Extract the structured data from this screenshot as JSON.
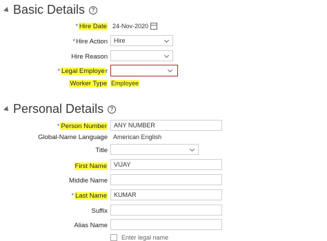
{
  "basic": {
    "title": "Basic Details",
    "fields": {
      "hire_date": {
        "label": "Hire Date",
        "value": "24-Nov-2020",
        "required": "*"
      },
      "hire_action": {
        "label": "Hire Action",
        "value": "Hire",
        "required": "*"
      },
      "hire_reason": {
        "label": "Hire Reason",
        "value": ""
      },
      "legal_employer": {
        "label_a": "Legal Employe",
        "label_b": "r",
        "value": "",
        "required": "*"
      },
      "worker_type": {
        "label": "Worker Type",
        "value": "Employee"
      }
    }
  },
  "personal": {
    "title": "Personal Details",
    "fields": {
      "person_number": {
        "label": "Person Number",
        "value": "ANY NUMBER",
        "required": "*"
      },
      "global_name_language": {
        "label": "Global-Name Language",
        "value": "American English"
      },
      "title": {
        "label": "Title",
        "value": ""
      },
      "first_name": {
        "label": "First Name",
        "value": "VIJAY"
      },
      "middle_name": {
        "label": "Middle Name",
        "value": ""
      },
      "last_name": {
        "label": "Last Name",
        "value": "KUMAR",
        "required": "*"
      },
      "suffix": {
        "label": "Suffix",
        "value": ""
      },
      "alias_name": {
        "label": "Alias Name",
        "value": ""
      },
      "enter_legal_name": {
        "label": "Enter legal name"
      }
    }
  },
  "icons": {
    "help": "question-circle-icon",
    "calendar": "calendar-icon",
    "dropdown": "chevron-down-icon",
    "collapse": "collapse-triangle-icon"
  },
  "colors": {
    "highlight": "#ffff3a",
    "required": "#2a59a8",
    "error_border": "#b5232b"
  }
}
